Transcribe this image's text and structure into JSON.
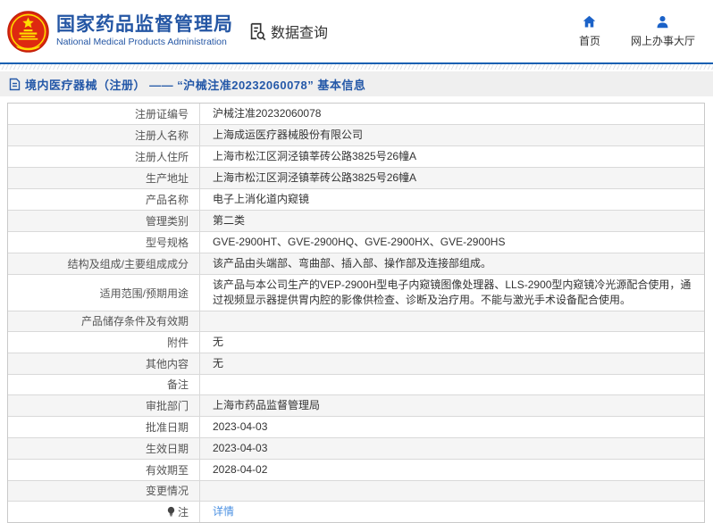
{
  "header": {
    "title": "国家药品监督管理局",
    "subtitle": "National Medical Products Administration",
    "data_query_label": "数据查询",
    "nav": [
      {
        "label": "首页",
        "icon": "home-icon"
      },
      {
        "label": "网上办事大厅",
        "icon": "user-icon"
      }
    ]
  },
  "breadcrumb": {
    "text": "境内医疗器械（注册） —— “沪械注准20232060078” 基本信息"
  },
  "colors": {
    "brand_blue": "#2456a4",
    "rule_blue": "#1760b2",
    "icon_blue": "#1b62c8",
    "breadcrumb_bg": "#efefef",
    "link_blue": "#4a90e2",
    "alt_row_bg": "#f5f5f5",
    "emblem_red": "#de2910",
    "emblem_gold": "#ffde00"
  },
  "table": {
    "rows": [
      {
        "label": "注册证编号",
        "value": "沪械注准20232060078"
      },
      {
        "label": "注册人名称",
        "value": "上海成运医疗器械股份有限公司"
      },
      {
        "label": "注册人住所",
        "value": "上海市松江区洞泾镇莘砖公路3825号26幢A"
      },
      {
        "label": "生产地址",
        "value": "上海市松江区洞泾镇莘砖公路3825号26幢A"
      },
      {
        "label": "产品名称",
        "value": "电子上消化道内窥镜"
      },
      {
        "label": "管理类别",
        "value": "第二类"
      },
      {
        "label": "型号规格",
        "value": "GVE-2900HT、GVE-2900HQ、GVE-2900HX、GVE-2900HS"
      },
      {
        "label": "结构及组成/主要组成成分",
        "value": "该产品由头端部、弯曲部、插入部、操作部及连接部组成。"
      },
      {
        "label": "适用范围/预期用途",
        "value": "该产品与本公司生产的VEP-2900H型电子内窥镜图像处理器、LLS-2900型内窥镜冷光源配合使用，通过视频显示器提供胃内腔的影像供检查、诊断及治疗用。不能与激光手术设备配合使用。"
      },
      {
        "label": "产品储存条件及有效期",
        "value": ""
      },
      {
        "label": "附件",
        "value": "无"
      },
      {
        "label": "其他内容",
        "value": "无"
      },
      {
        "label": "备注",
        "value": ""
      },
      {
        "label": "审批部门",
        "value": "上海市药品监督管理局"
      },
      {
        "label": "批准日期",
        "value": "2023-04-03"
      },
      {
        "label": "生效日期",
        "value": "2023-04-03"
      },
      {
        "label": "有效期至",
        "value": "2028-04-02"
      },
      {
        "label": "变更情况",
        "value": ""
      },
      {
        "label": "注",
        "value": "详情",
        "link": true,
        "icon": "note-icon"
      }
    ]
  }
}
